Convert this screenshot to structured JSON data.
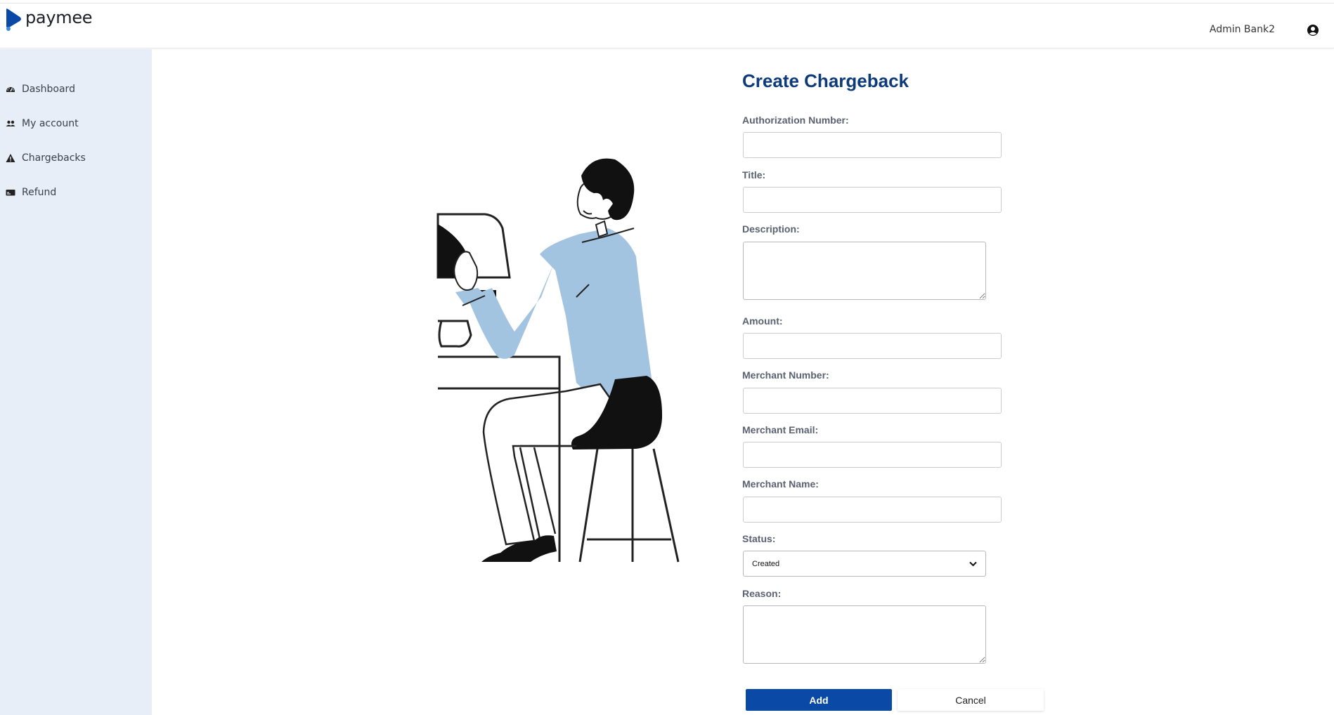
{
  "brand": {
    "name": "paymee",
    "color": "#0a4aa6"
  },
  "header": {
    "user_name": "Admin Bank2",
    "user_icon": "user-circle-icon"
  },
  "sidebar": {
    "items": [
      {
        "label": "Dashboard",
        "icon": "gauge-icon"
      },
      {
        "label": "My account",
        "icon": "users-icon"
      },
      {
        "label": "Chargebacks",
        "icon": "warning-icon"
      },
      {
        "label": "Refund",
        "icon": "card-icon"
      }
    ]
  },
  "form": {
    "title": "Create Chargeback",
    "fields": {
      "authorization_number": {
        "label": "Authorization Number:",
        "value": ""
      },
      "title": {
        "label": "Title:",
        "value": ""
      },
      "description": {
        "label": "Description:",
        "value": ""
      },
      "amount": {
        "label": "Amount:",
        "value": ""
      },
      "merchant_number": {
        "label": "Merchant Number:",
        "value": ""
      },
      "merchant_email": {
        "label": "Merchant Email:",
        "value": ""
      },
      "merchant_name": {
        "label": "Merchant Name:",
        "value": ""
      },
      "status": {
        "label": "Status:",
        "value": "Created"
      },
      "reason": {
        "label": "Reason:",
        "value": ""
      }
    },
    "buttons": {
      "add": "Add",
      "cancel": "Cancel"
    }
  },
  "colors": {
    "title": "#0d3a7a",
    "sidebar_bg": "#e8eef8",
    "shirt": "#a3c4e1",
    "button_primary": "#0a4aa6"
  }
}
